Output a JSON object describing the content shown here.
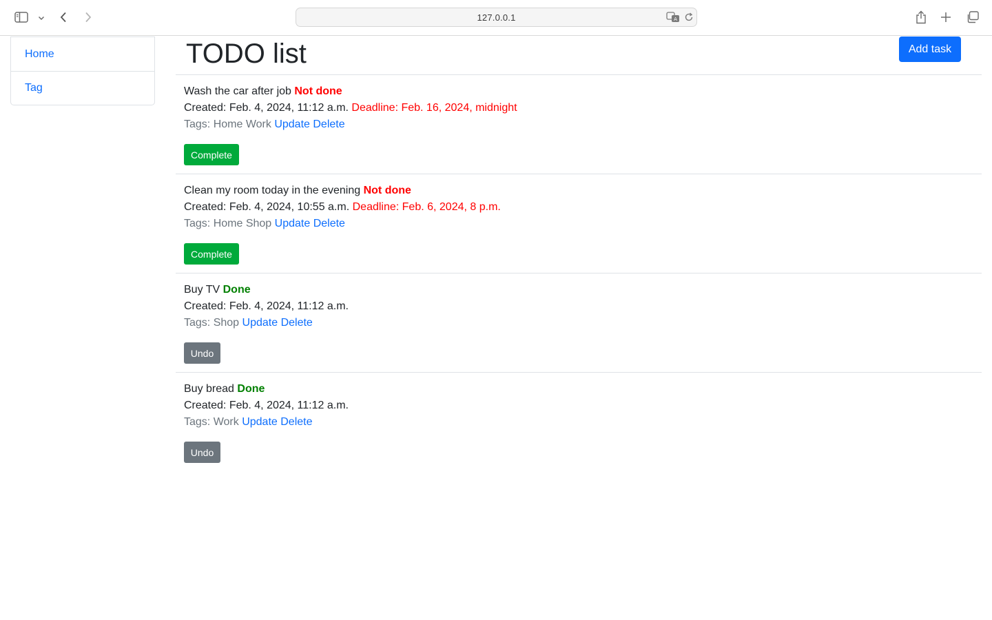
{
  "browser": {
    "url": "127.0.0.1"
  },
  "sidebar": {
    "items": [
      {
        "label": "Home"
      },
      {
        "label": "Tag"
      }
    ]
  },
  "page": {
    "title": "TODO list",
    "add_button": "Add task"
  },
  "tasks": [
    {
      "title": "Wash the car after job",
      "status": "Not done",
      "created": "Created: Feb. 4, 2024, 11:12 a.m.",
      "deadline": "Deadline: Feb. 16, 2024, midnight",
      "tags": "Tags: Home Work",
      "update": "Update",
      "delete": "Delete",
      "action": "Complete"
    },
    {
      "title": "Clean my room today in the evening",
      "status": "Not done",
      "created": "Created: Feb. 4, 2024, 10:55 a.m.",
      "deadline": "Deadline: Feb. 6, 2024, 8 p.m.",
      "tags": "Tags: Home Shop",
      "update": "Update",
      "delete": "Delete",
      "action": "Complete"
    },
    {
      "title": "Buy TV",
      "status": "Done",
      "created": "Created: Feb. 4, 2024, 11:12 a.m.",
      "tags": "Tags: Shop",
      "update": "Update",
      "delete": "Delete",
      "action": "Undo"
    },
    {
      "title": "Buy bread",
      "status": "Done",
      "created": "Created: Feb. 4, 2024, 11:12 a.m.",
      "tags": "Tags: Work",
      "update": "Update",
      "delete": "Delete",
      "action": "Undo"
    }
  ],
  "colors": {
    "link": "#0d6efd",
    "not_done": "#ff0000",
    "done": "#008000",
    "complete_button": "#00aa3b",
    "undo_button": "#6c757d"
  }
}
